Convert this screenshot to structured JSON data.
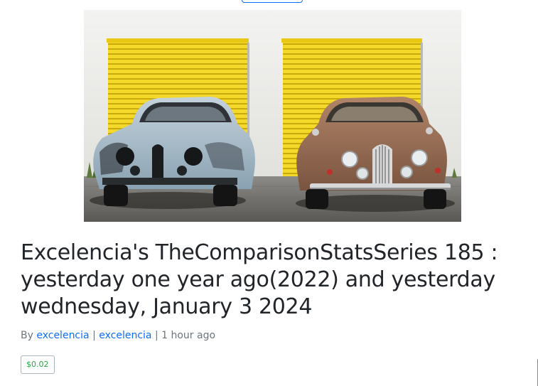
{
  "post": {
    "image_alt": "Two vintage cars parked in front of yellow garage doors",
    "title": "Excelencia's TheComparisonStatsSeries 185 : yesterday one year ago(2022) and yesterday wednesday, January 3 2024",
    "byline": {
      "prefix": "By",
      "author_link": "excelencia",
      "separator_1": "|",
      "community_link": "excelencia",
      "separator_2": "|",
      "time": "1 hour ago"
    },
    "payout": "$0.02"
  },
  "colors": {
    "link": "#0d6efd",
    "payout": "#28a745",
    "muted_text": "#6c757d",
    "title_text": "#212529",
    "garage_yellow": "#f2d21a"
  }
}
